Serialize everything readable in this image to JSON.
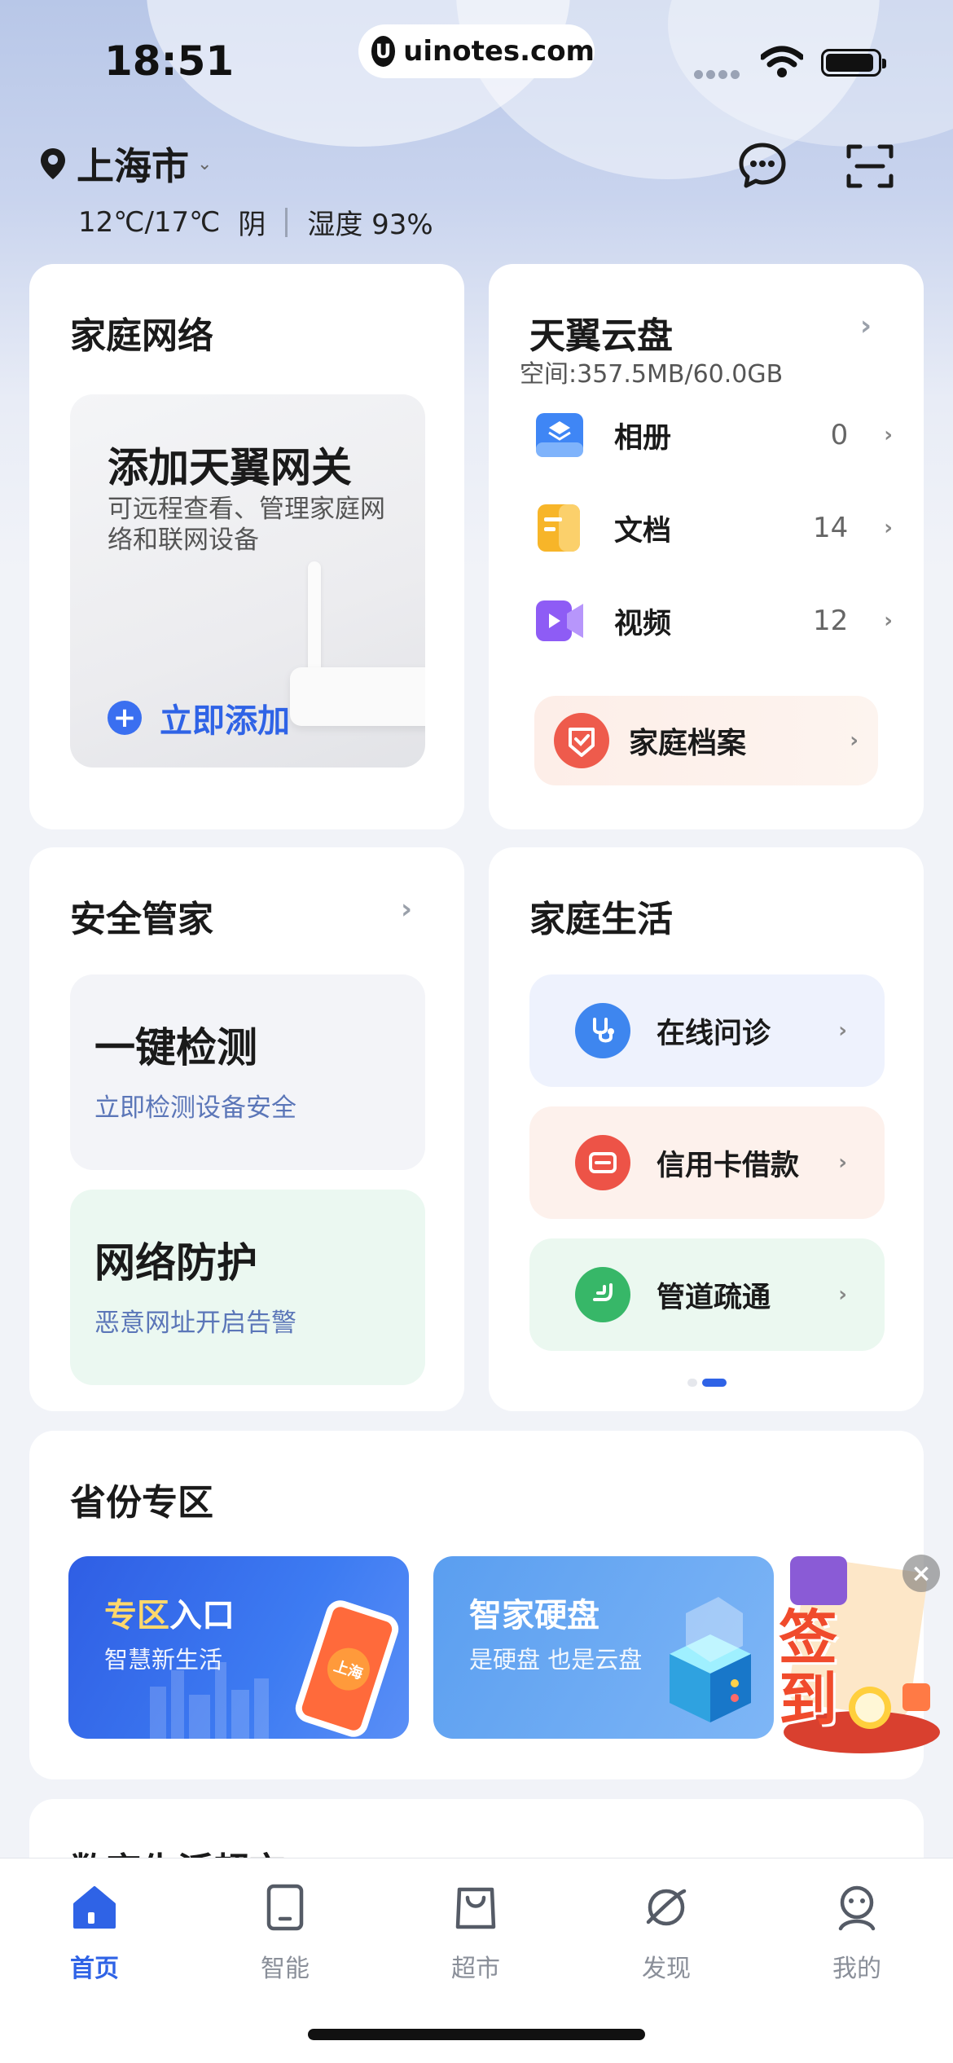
{
  "status_bar": {
    "time": "18:51",
    "url": "uinotes.com"
  },
  "location": {
    "city": "上海市",
    "temp": "12℃/17℃",
    "weather": "阴",
    "humidity": "湿度 93%"
  },
  "home_network": {
    "title": "家庭网络",
    "gateway_title": "添加天翼网关",
    "gateway_desc": "可远程查看、管理家庭网络和联网设备",
    "add_label": "立即添加"
  },
  "cloud_disk": {
    "title": "天翼云盘",
    "space": "空间:357.5MB/60.0GB",
    "items": [
      {
        "label": "相册",
        "count": "0",
        "icon": "album-icon"
      },
      {
        "label": "文档",
        "count": "14",
        "icon": "document-icon"
      },
      {
        "label": "视频",
        "count": "12",
        "icon": "video-icon"
      }
    ],
    "archive_label": "家庭档案"
  },
  "security": {
    "title": "安全管家",
    "check_title": "一键检测",
    "check_sub": "立即检测设备安全",
    "protect_title": "网络防护",
    "protect_sub": "恶意网址开启告警"
  },
  "family_life": {
    "title": "家庭生活",
    "items": [
      {
        "label": "在线问诊",
        "icon": "stethoscope-icon"
      },
      {
        "label": "信用卡借款",
        "icon": "credit-card-icon"
      },
      {
        "label": "管道疏通",
        "icon": "pipe-icon"
      }
    ]
  },
  "province": {
    "title": "省份专区",
    "banners": [
      {
        "title": "专区入口",
        "sub": "智慧新生活",
        "badge": "上海"
      },
      {
        "title": "智家硬盘",
        "sub": "是硬盘 也是云盘"
      }
    ]
  },
  "next_section": {
    "title": "数字生活超市"
  },
  "signin": {
    "label": "签到"
  },
  "bottom_nav": [
    {
      "label": "首页",
      "icon": "home-icon",
      "active": true
    },
    {
      "label": "智能",
      "icon": "smart-device-icon",
      "active": false
    },
    {
      "label": "超市",
      "icon": "shopping-bag-icon",
      "active": false
    },
    {
      "label": "发现",
      "icon": "discover-icon",
      "active": false
    },
    {
      "label": "我的",
      "icon": "profile-icon",
      "active": false
    }
  ],
  "colors": {
    "accent": "#2f63e6",
    "nav_inactive": "#8a8f99",
    "background": "#f1f3f8"
  }
}
